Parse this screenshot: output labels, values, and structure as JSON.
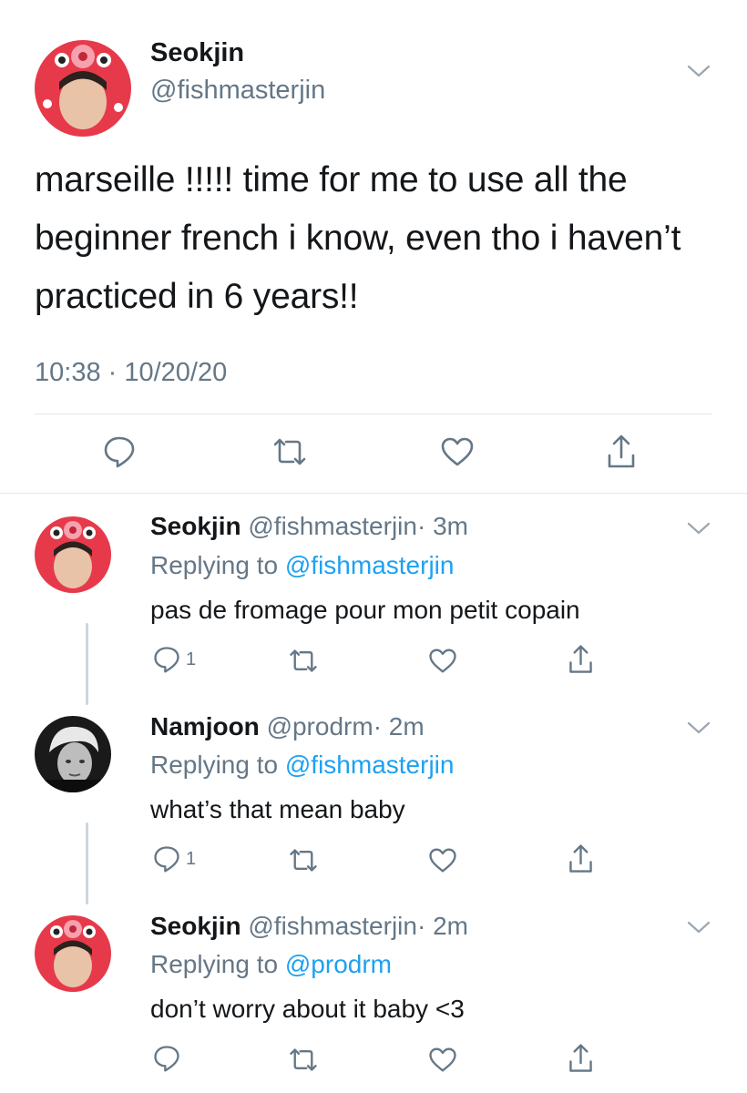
{
  "main_tweet": {
    "name": "Seokjin",
    "handle": "@fishmasterjin",
    "text": "marseille !!!!! time for me to use all the beginner french i know, even tho i haven’t practiced in 6 years!!",
    "timestamp": "10:38 · 10/20/20",
    "actions": [
      "reply-icon",
      "retweet-icon",
      "like-icon",
      "share-icon"
    ]
  },
  "replies": [
    {
      "name": "Seokjin",
      "handle": "@fishmasterjin",
      "time": "· 3m",
      "replying_prefix": "Replying to",
      "replying_to": "@fishmasterjin",
      "text": "pas de fromage pour mon petit copain",
      "reply_count": "1"
    },
    {
      "name": "Namjoon",
      "handle": "@prodrm",
      "time": "· 2m",
      "replying_prefix": "Replying to",
      "replying_to": "@fishmasterjin",
      "text": "what’s that mean baby",
      "reply_count": "1"
    },
    {
      "name": "Seokjin",
      "handle": "@fishmasterjin",
      "time": "· 2m",
      "replying_prefix": "Replying to",
      "replying_to": "@prodrm",
      "text": "don’t worry about it baby <3",
      "reply_count": ""
    }
  ],
  "colors": {
    "text": "#14171a",
    "secondary": "#657786",
    "link": "#1da1f2",
    "divider": "#e1e8ed",
    "thread_line": "#ccd6dd"
  }
}
